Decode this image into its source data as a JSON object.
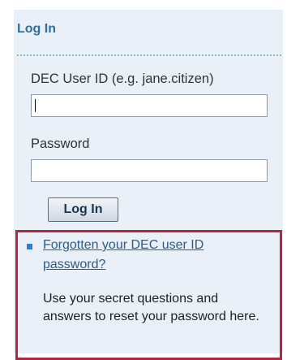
{
  "login": {
    "title": "Log In",
    "userid_label": "DEC User ID (e.g. jane.citizen)",
    "userid_value": "",
    "password_label": "Password",
    "password_value": "",
    "button_label": "Log In"
  },
  "help": {
    "link_text": "Forgotten your DEC user ID password?",
    "description": "Use your secret questions and answers to reset your password here."
  },
  "colors": {
    "panel_background": "#e9f0f7",
    "title": "#2e6fa8",
    "link": "#2b5c8a",
    "highlight_border": "#b5253c",
    "bullet": "#2d7fc9"
  }
}
